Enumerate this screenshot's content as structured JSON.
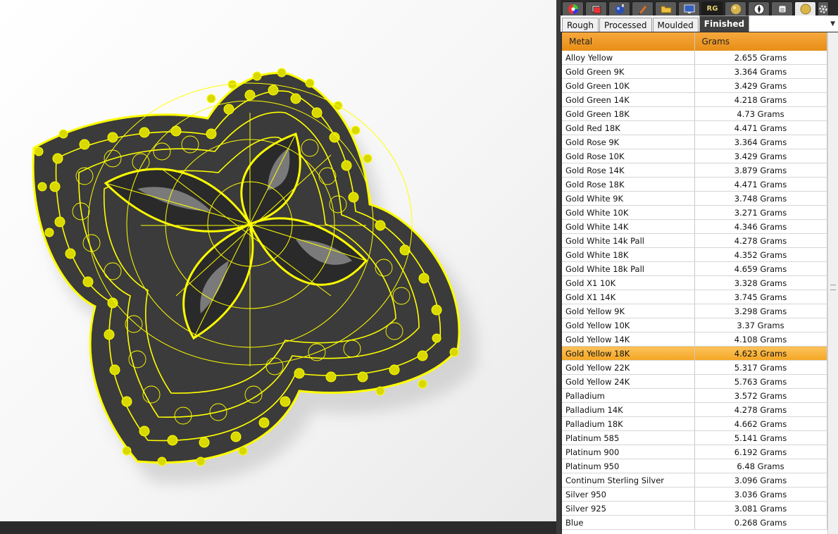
{
  "toolbar": {
    "icons": [
      "color-wheel-icon",
      "layers-icon",
      "render-sphere-icon",
      "pencil-icon",
      "folder-icon",
      "display-icon",
      "rg-logo-icon",
      "gold-sphere-icon",
      "compass-icon",
      "ring-icon",
      "gold-coin-icon",
      "gear-icon"
    ],
    "rg_label": "RG"
  },
  "tabs": [
    "Rough",
    "Processed",
    "Moulded",
    "Finished"
  ],
  "active_tab": "Finished",
  "table": {
    "headers": [
      "Metal",
      "Grams"
    ],
    "rows": [
      {
        "metal": "Alloy Yellow",
        "grams": "2.655 Grams"
      },
      {
        "metal": "Gold Green 9K",
        "grams": "3.364 Grams"
      },
      {
        "metal": "Gold Green 10K",
        "grams": "3.429 Grams"
      },
      {
        "metal": "Gold Green 14K",
        "grams": "4.218 Grams"
      },
      {
        "metal": "Gold Green 18K",
        "grams": "4.73 Grams"
      },
      {
        "metal": "Gold Red 18K",
        "grams": "4.471 Grams"
      },
      {
        "metal": "Gold Rose 9K",
        "grams": "3.364 Grams"
      },
      {
        "metal": "Gold Rose 10K",
        "grams": "3.429 Grams"
      },
      {
        "metal": "Gold Rose 14K",
        "grams": "3.879 Grams"
      },
      {
        "metal": "Gold Rose 18K",
        "grams": "4.471 Grams"
      },
      {
        "metal": "Gold White 9K",
        "grams": "3.748 Grams"
      },
      {
        "metal": "Gold White 10K",
        "grams": "3.271 Grams"
      },
      {
        "metal": "Gold White 14K",
        "grams": "4.346 Grams"
      },
      {
        "metal": "Gold White 14k Pall",
        "grams": "4.278 Grams"
      },
      {
        "metal": "Gold White 18K",
        "grams": "4.352 Grams"
      },
      {
        "metal": "Gold White 18k Pall",
        "grams": "4.659 Grams"
      },
      {
        "metal": "Gold X1 10K",
        "grams": "3.328 Grams"
      },
      {
        "metal": "Gold X1 14K",
        "grams": "3.745 Grams"
      },
      {
        "metal": "Gold Yellow 9K",
        "grams": "3.298 Grams"
      },
      {
        "metal": "Gold Yellow 10K",
        "grams": "3.37 Grams"
      },
      {
        "metal": "Gold Yellow 14K",
        "grams": "4.108 Grams"
      },
      {
        "metal": "Gold Yellow 18K",
        "grams": "4.623 Grams"
      },
      {
        "metal": "Gold Yellow 22K",
        "grams": "5.317 Grams"
      },
      {
        "metal": "Gold Yellow 24K",
        "grams": "5.763 Grams"
      },
      {
        "metal": "Palladium",
        "grams": "3.572 Grams"
      },
      {
        "metal": "Palladium 14K",
        "grams": "4.278 Grams"
      },
      {
        "metal": "Palladium 18K",
        "grams": "4.662 Grams"
      },
      {
        "metal": "Platinum 585",
        "grams": "5.141 Grams"
      },
      {
        "metal": "Platinum 900",
        "grams": "6.192 Grams"
      },
      {
        "metal": "Platinum 950",
        "grams": "6.48 Grams"
      },
      {
        "metal": "Continum Sterling Silver",
        "grams": "3.096 Grams"
      },
      {
        "metal": "Silver 950",
        "grams": "3.036 Grams"
      },
      {
        "metal": "Silver 925",
        "grams": "3.081 Grams"
      },
      {
        "metal": "Blue",
        "grams": "0.268 Grams"
      }
    ],
    "selected_row": 21
  },
  "colors": {
    "header_orange": "#f0a030",
    "selection_orange": "#f5a623",
    "wireframe_yellow": "#ffff00",
    "model_dark": "#3a3a3a"
  }
}
